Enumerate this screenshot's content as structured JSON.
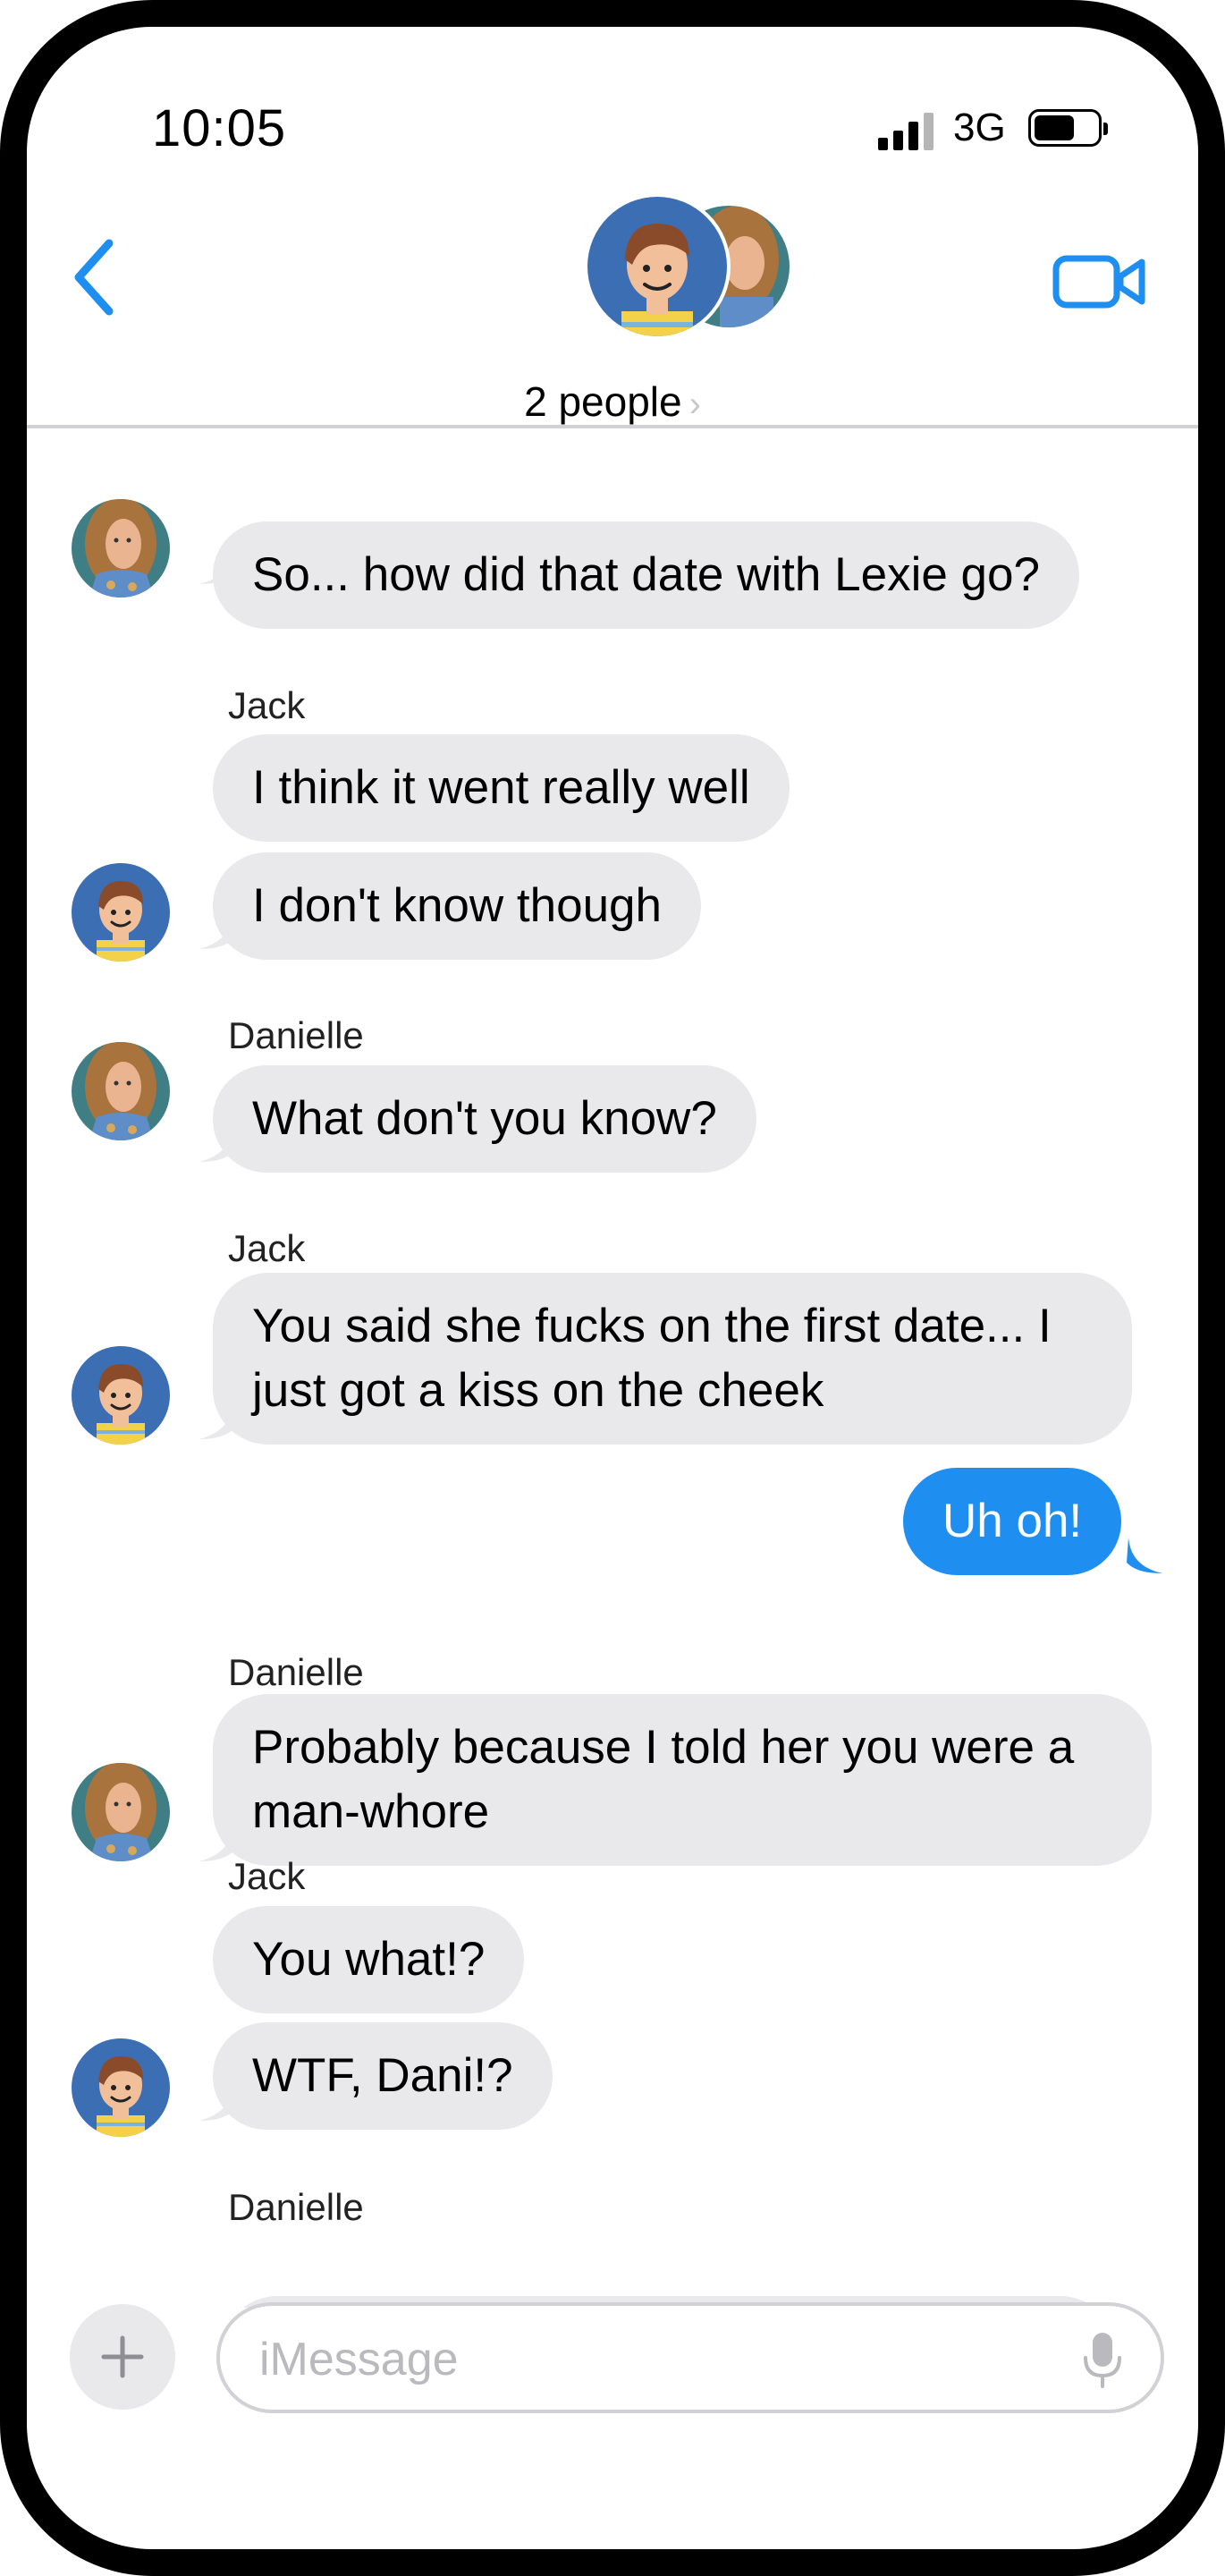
{
  "status_bar": {
    "time": "10:05",
    "network": "3G",
    "battery_fraction": 0.65
  },
  "header": {
    "group_title": "2 people",
    "chevron": "›",
    "back_icon": "chevron-left-icon",
    "video_icon": "video-camera-icon"
  },
  "colors": {
    "accent": "#1f8ef1",
    "incoming_bubble": "#e9e9eb",
    "outgoing_bubble": "#1f8ef1"
  },
  "messages": [
    {
      "sender": "",
      "text": "So... how did that date with Lexie go?",
      "direction": "in",
      "from": "Danielle"
    },
    {
      "sender": "Jack",
      "text": "I think it went really well",
      "direction": "in",
      "from": "Jack"
    },
    {
      "sender": "",
      "text": "I don't know though",
      "direction": "in",
      "from": "Jack"
    },
    {
      "sender": "Danielle",
      "text": "What don't you know?",
      "direction": "in",
      "from": "Danielle"
    },
    {
      "sender": "Jack",
      "text": "You said she fucks on the first date... I just got a kiss on the cheek",
      "direction": "in",
      "from": "Jack"
    },
    {
      "sender": "",
      "text": "Uh oh!",
      "direction": "out",
      "from": "Me"
    },
    {
      "sender": "Danielle",
      "text": "Probably because I told her you were a man-whore",
      "direction": "in",
      "from": "Danielle"
    },
    {
      "sender": "Jack",
      "text": "You what!?",
      "direction": "in",
      "from": "Jack"
    },
    {
      "sender": "",
      "text": "WTF, Dani!?",
      "direction": "in",
      "from": "Jack"
    },
    {
      "sender": "Danielle",
      "text": "",
      "direction": "in",
      "from": "Danielle"
    }
  ],
  "composer": {
    "placeholder": "iMessage",
    "value": "",
    "plus_icon": "plus-icon",
    "mic_icon": "microphone-icon"
  }
}
